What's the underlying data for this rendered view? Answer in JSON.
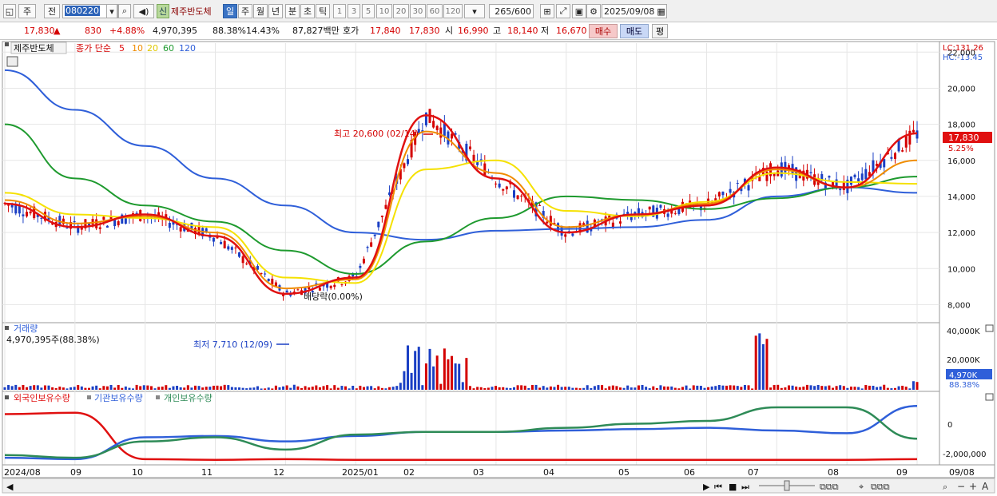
{
  "toolbar": {
    "period_options": [
      "주",
      "전"
    ],
    "stock_code": "080220",
    "new_badge": "신",
    "stock_name": "제주반도체",
    "intervals": [
      "일",
      "주",
      "월",
      "년",
      "분",
      "초",
      "틱"
    ],
    "selected_interval": "일",
    "minute_steps": [
      "1",
      "3",
      "5",
      "10",
      "20",
      "30",
      "60",
      "120"
    ],
    "bar_count": "265",
    "bar_total": "/600",
    "date": "2025/09/08"
  },
  "quote": {
    "price": "17,830",
    "up_arrow": "▲",
    "change": "830",
    "change_pct": "+4.88%",
    "volume": "4,970,395",
    "volume_ratio": "88.38%",
    "turnover": "14.43%",
    "amount": "87,827백만",
    "ask_label": "호가",
    "ask": "17,840",
    "bid": "17,830",
    "open_label": "시",
    "open": "16,990",
    "high_label": "고",
    "high": "18,140",
    "low_label": "저",
    "low": "16,670",
    "buy_label": "매수",
    "sell_label": "매도",
    "eval_label": "평"
  },
  "price_panel": {
    "title": "제주반도체",
    "ma_prefix": "종가 단순",
    "ma_periods": [
      "5",
      "10",
      "20",
      "60",
      "120"
    ],
    "lc_label": "LC:131.26",
    "hc_label": "HC:-13.45",
    "last_price": "17,830",
    "last_pct": "5.25%",
    "high_annotation": "최고 20,600 (02/14)",
    "low_annotation": "최저 7,710 (12/09)",
    "dividend_annotation": "배당락(0.00%)",
    "y_ticks": [
      "22,000",
      "20,000",
      "18,000",
      "16,000",
      "14,000",
      "12,000",
      "10,000",
      "8,000"
    ]
  },
  "volume_panel": {
    "title": "거래량",
    "value": "4,970,395주(88.38%)",
    "y_ticks": [
      "40,000K",
      "20,000K"
    ],
    "last_value": "4,970K",
    "last_pct": "88.38%"
  },
  "holding_panel": {
    "foreign_label": "외국인보유수량",
    "institution_label": "기관보유수량",
    "individual_label": "개인보유수량",
    "y_ticks": [
      "0",
      "-2,000,000"
    ]
  },
  "x_axis": {
    "labels": [
      "2024/08",
      "09",
      "10",
      "11",
      "12",
      "2025/01",
      "02",
      "03",
      "04",
      "05",
      "06",
      "07",
      "08",
      "09",
      "09/08"
    ]
  },
  "colors": {
    "ma5": "#e01010",
    "ma10": "#f08c00",
    "ma20": "#f5e100",
    "ma60": "#1e9a2e",
    "ma120": "#2f5fd9",
    "up": "#d40000",
    "down": "#1a3fc4",
    "foreign": "#e01010",
    "institution": "#2f5fd9",
    "individual": "#2e8b57"
  },
  "chart_data": {
    "type": "line",
    "x": [
      "2024/08",
      "2024/09",
      "2024/10",
      "2024/11",
      "2024/12",
      "2025/01",
      "2025/02",
      "2025/03",
      "2025/04",
      "2025/05",
      "2025/06",
      "2025/07",
      "2025/08",
      "2025/09"
    ],
    "series": [
      {
        "name": "5",
        "values": [
          13600,
          12300,
          13000,
          11800,
          8600,
          9500,
          18500,
          15000,
          12000,
          13000,
          13500,
          15600,
          14500,
          17500
        ]
      },
      {
        "name": "10",
        "values": [
          13800,
          12500,
          12900,
          12000,
          8900,
          9400,
          17600,
          15300,
          12300,
          13000,
          13600,
          15500,
          14500,
          16000
        ]
      },
      {
        "name": "20",
        "values": [
          14200,
          13000,
          12800,
          12300,
          9500,
          9200,
          15500,
          16000,
          13200,
          12900,
          13700,
          15300,
          14800,
          14700
        ]
      },
      {
        "name": "60",
        "values": [
          18000,
          15000,
          13500,
          12600,
          11000,
          9700,
          11500,
          12800,
          14000,
          13800,
          13300,
          13900,
          14500,
          15100
        ]
      },
      {
        "name": "120",
        "values": [
          21000,
          18800,
          16800,
          15000,
          13500,
          12000,
          11600,
          12100,
          12200,
          12300,
          12700,
          14000,
          14500,
          14200
        ]
      }
    ],
    "price_range": [
      7000,
      22500
    ],
    "volume_range_k": [
      0,
      40000
    ],
    "price_ticks": [
      22000,
      20000,
      18000,
      16000,
      14000,
      12000,
      10000,
      8000
    ],
    "annotations": [
      {
        "label": "최고 20,600 (02/14)",
        "value": 20600,
        "date": "2025/02/14"
      },
      {
        "label": "최저 7,710 (12/09)",
        "value": 7710,
        "date": "2024/12/09"
      }
    ],
    "last_close": 17830,
    "last_volume": 4970395,
    "holdings": [
      {
        "name": "외국인보유수량",
        "values": [
          1000000,
          1100000,
          -2300000,
          -2350000,
          -2300000,
          -2350000,
          -2350000,
          -2350000,
          -2350000,
          -2350000,
          -2350000,
          -2350000,
          -2350000,
          -2300000
        ]
      },
      {
        "name": "기관보유수량",
        "values": [
          -2200000,
          -2300000,
          -700000,
          -600000,
          -1000000,
          -600000,
          -300000,
          -300000,
          -200000,
          -100000,
          0,
          -200000,
          -400000,
          1600000
        ]
      },
      {
        "name": "개인보유수량",
        "values": [
          -2000000,
          -2200000,
          -1000000,
          -700000,
          -1600000,
          -500000,
          -300000,
          -300000,
          0,
          300000,
          500000,
          1500000,
          1500000,
          -800000
        ]
      }
    ],
    "grid": true,
    "legend": "top-left"
  }
}
